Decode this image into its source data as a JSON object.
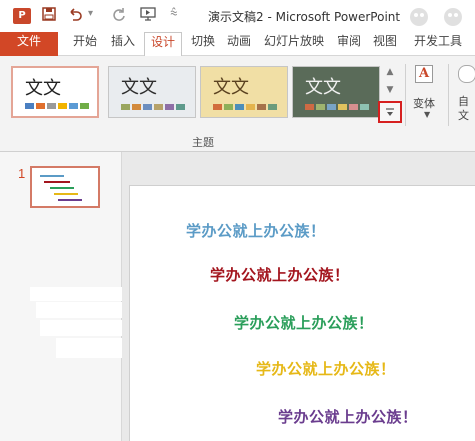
{
  "window": {
    "title": "演示文稿2 - Microsoft PowerPoint",
    "app_icon": "powerpoint-icon",
    "app_icon_letter": "P"
  },
  "quick_access": {
    "save_icon": "save-icon",
    "undo_icon": "undo-icon",
    "redo_icon": "redo-icon",
    "start_from_beginning_icon": "start-slideshow-icon",
    "customize_icon": "chevron-down-icon"
  },
  "tabs": [
    {
      "label": "文件"
    },
    {
      "label": "开始"
    },
    {
      "label": "插入"
    },
    {
      "label": "设计"
    },
    {
      "label": "切换"
    },
    {
      "label": "动画"
    },
    {
      "label": "幻灯片放映"
    },
    {
      "label": "审阅"
    },
    {
      "label": "视图"
    },
    {
      "label": "开发工具"
    }
  ],
  "active_tab": "设计",
  "ribbon": {
    "themes_group_label": "主题",
    "themes": [
      {
        "text": "文文",
        "text_color": "#222222",
        "background": "#ffffff",
        "swatches": [
          "#4a7fc1",
          "#e06f2d",
          "#9a9a9a",
          "#f2b400",
          "#5b9bd5",
          "#70ad47"
        ],
        "selected": true
      },
      {
        "text": "文文",
        "text_color": "#2e2e2e",
        "background": "#e9ecef",
        "swatches": [
          "#9aa65f",
          "#d38a3c",
          "#6c8ebf",
          "#b6a26a",
          "#8e6fa6",
          "#5e9a8c"
        ],
        "selected": false
      },
      {
        "text": "文文",
        "text_color": "#5b4220",
        "background": "#f1dfa5",
        "swatches": [
          "#d26d3c",
          "#8db05a",
          "#4c8eba",
          "#e4b44d",
          "#a6724a",
          "#6c9c7c"
        ],
        "selected": false
      },
      {
        "text": "文文",
        "text_color": "#f0f0f0",
        "background": "#5a6b59",
        "swatches": [
          "#ce6a44",
          "#9fb46f",
          "#79a4c7",
          "#e1c25e",
          "#d68f8f",
          "#8ec2b2"
        ],
        "selected": false
      }
    ],
    "scroll_up_icon": "triangle-up-icon",
    "scroll_down_icon": "triangle-down-icon",
    "more_icon": "more-themes-icon",
    "variants_label": "变体",
    "variants_icon": "variant-icon",
    "customize_label": "自\n文"
  },
  "thumbnails": {
    "slide_number": "1"
  },
  "slide": {
    "lines": [
      {
        "text": "学办公就上办公族！",
        "color": "#5b9bc6"
      },
      {
        "text": "学办公就上办公族！",
        "color": "#a3151e"
      },
      {
        "text": "学办公就上办公族！",
        "color": "#2a9e5a"
      },
      {
        "text": "学办公就上办公族！",
        "color": "#e6b817"
      },
      {
        "text": "学办公就上办公族！",
        "color": "#6a3c8e"
      }
    ]
  }
}
